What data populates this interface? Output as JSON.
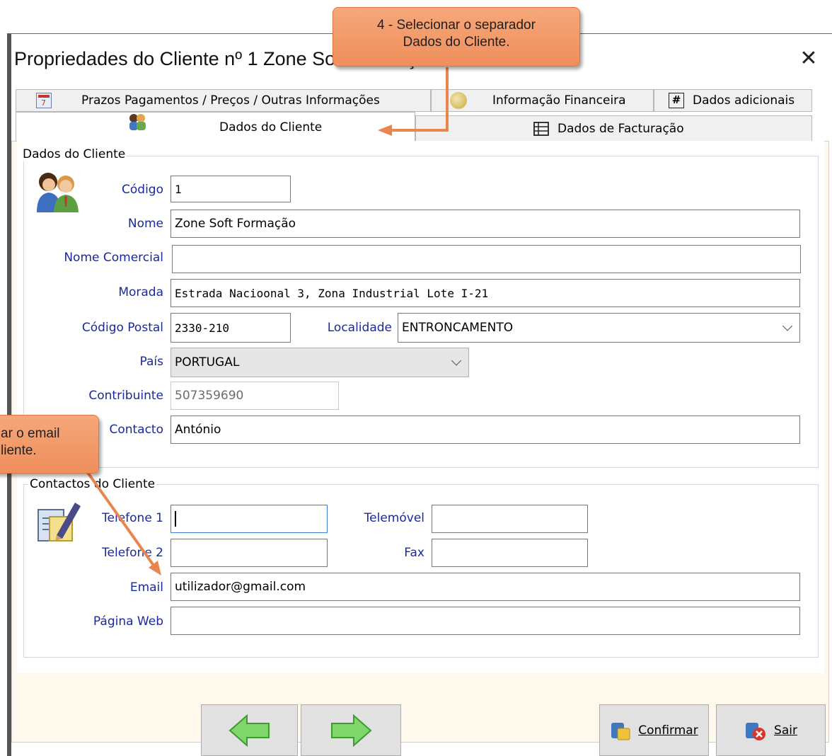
{
  "window": {
    "title": "Propriedades do Cliente nº 1 Zone Soft Formação"
  },
  "tabs": {
    "row1": [
      {
        "label": "Prazos Pagamentos / Preços / Outras Informações"
      },
      {
        "label": "Informação Financeira"
      },
      {
        "label": "Dados adicionais"
      }
    ],
    "row2": [
      {
        "label": "Dados do Cliente",
        "active": true
      },
      {
        "label": "Dados de Facturação"
      }
    ]
  },
  "client_group": {
    "title": "Dados do Cliente",
    "codigo": {
      "label": "Código",
      "value": "1"
    },
    "nome": {
      "label": "Nome",
      "value": "Zone Soft Formação"
    },
    "nome_comercial": {
      "label": "Nome Comercial",
      "value": ""
    },
    "morada": {
      "label": "Morada",
      "value": "Estrada Nacioonal 3, Zona Industrial Lote I-21"
    },
    "codigo_postal": {
      "label": "Código Postal",
      "value": "2330-210"
    },
    "localidade": {
      "label": "Localidade",
      "value": "ENTRONCAMENTO"
    },
    "pais": {
      "label": "País",
      "value": "PORTUGAL"
    },
    "contribuinte": {
      "label": "Contribuinte",
      "value": "507359690"
    },
    "contacto": {
      "label": "Contacto",
      "value": "António"
    }
  },
  "contacts_group": {
    "title": "Contactos do Cliente",
    "telefone1": {
      "label": "Telefone 1",
      "value": ""
    },
    "telemovel": {
      "label": "Telemóvel",
      "value": ""
    },
    "telefone2": {
      "label": "Telefone 2",
      "value": ""
    },
    "fax": {
      "label": "Fax",
      "value": ""
    },
    "email": {
      "label": "Email",
      "value": "utilizador@gmail.com"
    },
    "pagina_web": {
      "label": "Página Web",
      "value": ""
    }
  },
  "buttons": {
    "confirm_label": "Confirmar",
    "exit_label": "Sair"
  },
  "callouts": {
    "step4_line1": "4 - Selecionar o separador",
    "step4_line2": "Dados do Cliente.",
    "email_line1": "ar o email",
    "email_line2": "liente."
  },
  "colors": {
    "label_blue": "#1a2a9c",
    "callout_orange": "#ef8f5c",
    "panel_bg": "#fff8ec",
    "arrow_green": "#59c04a"
  }
}
